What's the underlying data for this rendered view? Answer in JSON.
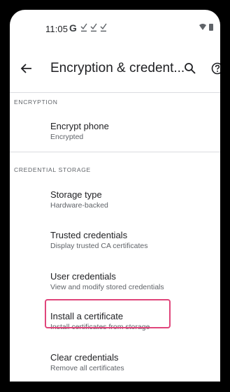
{
  "status_bar": {
    "time": "11:05",
    "notification_g": "G",
    "icons": [
      "check-icon",
      "check-icon",
      "check-icon",
      "wifi-icon",
      "battery-icon"
    ]
  },
  "app_bar": {
    "title": "Encryption & credent...",
    "back_icon": "arrow-back-icon",
    "search_icon": "search-icon",
    "help_icon": "help-icon"
  },
  "sections": [
    {
      "header": "ENCRYPTION",
      "items": [
        {
          "title": "Encrypt phone",
          "summary": "Encrypted"
        }
      ]
    },
    {
      "header": "CREDENTIAL STORAGE",
      "items": [
        {
          "title": "Storage type",
          "summary": "Hardware-backed"
        },
        {
          "title": "Trusted credentials",
          "summary": "Display trusted CA certificates"
        },
        {
          "title": "User credentials",
          "summary": "View and modify stored credentials"
        },
        {
          "title": "Install a certificate",
          "summary": "Install certificates from storage"
        },
        {
          "title": "Clear credentials",
          "summary": "Remove all certificates"
        }
      ]
    }
  ],
  "colors": {
    "highlight": "#e0457b",
    "text_primary": "#202124",
    "text_secondary": "#5f6368",
    "divider": "#dadce0"
  }
}
